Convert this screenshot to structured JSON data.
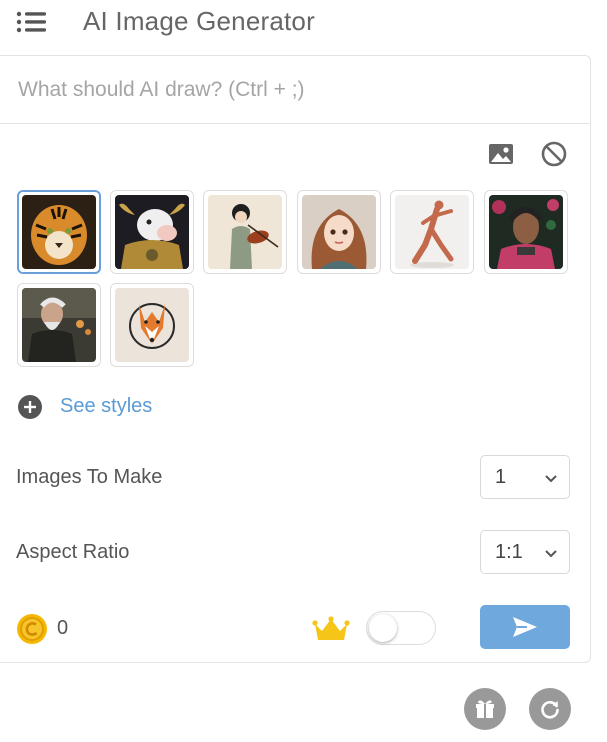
{
  "header": {
    "title": "AI Image Generator",
    "menu_icon": "menu-list-icon"
  },
  "prompt": {
    "value": "",
    "placeholder": "What should AI draw? (Ctrl + ;)"
  },
  "tools": {
    "image_icon": "image-icon",
    "clear_icon": "no-entry-icon"
  },
  "styles": {
    "thumbnails": [
      {
        "subject": "tiger",
        "selected": true
      },
      {
        "subject": "robot-cow",
        "selected": false
      },
      {
        "subject": "violinist",
        "selected": false
      },
      {
        "subject": "anime-girl",
        "selected": false
      },
      {
        "subject": "dancing-figure",
        "selected": false
      },
      {
        "subject": "cyborg-woman",
        "selected": false
      },
      {
        "subject": "old-man-painting",
        "selected": false
      },
      {
        "subject": "dog-logo",
        "selected": false
      }
    ],
    "see_styles_label": "See styles"
  },
  "settings": {
    "images_to_make": {
      "label": "Images To Make",
      "value": "1"
    },
    "aspect_ratio": {
      "label": "Aspect Ratio",
      "value": "1:1"
    }
  },
  "footer": {
    "coin_count": "0",
    "premium_toggle_on": false
  },
  "colors": {
    "accent": "#6fa8dc",
    "link": "#5b9bd5",
    "coin": "#f5b800",
    "crown": "#f5c518",
    "round_buttons": "#999999"
  }
}
